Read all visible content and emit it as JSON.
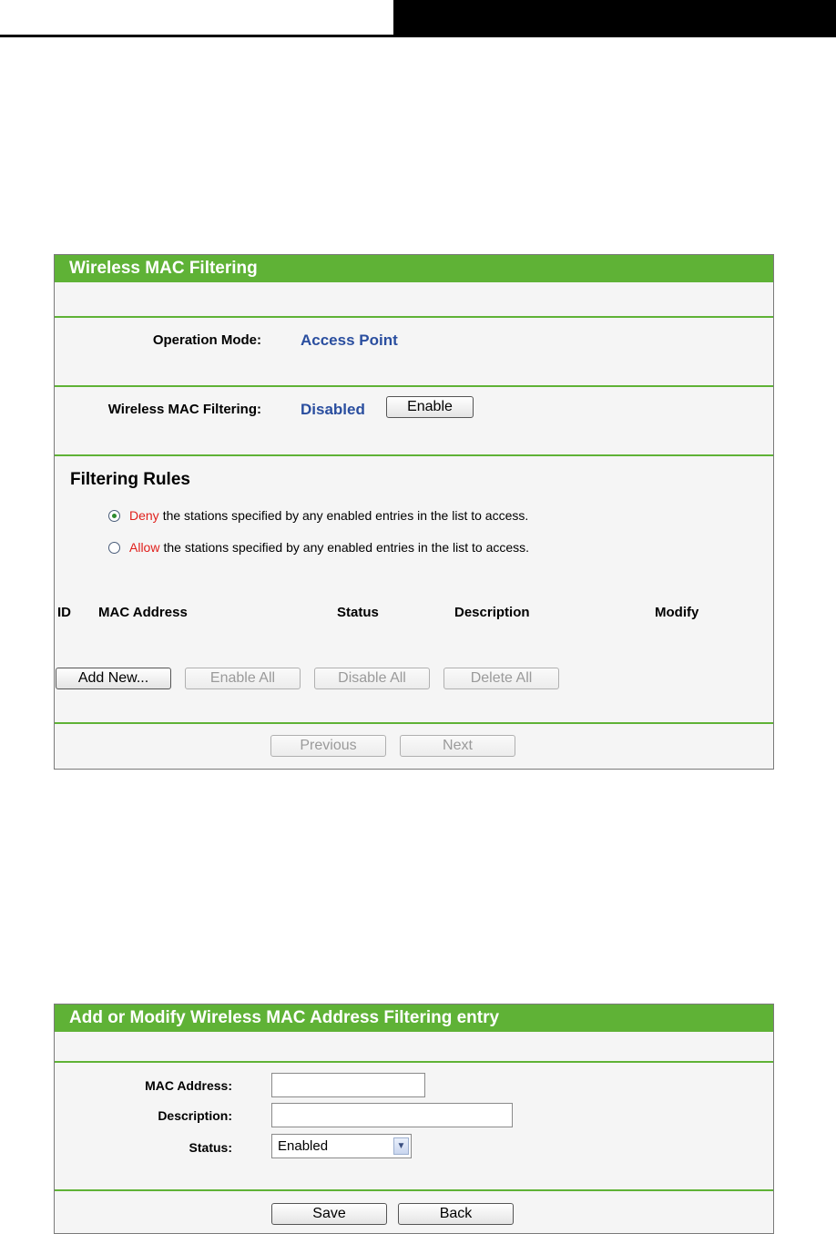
{
  "filtering_panel": {
    "title": "Wireless MAC Filtering",
    "operation_mode_label": "Operation Mode:",
    "operation_mode_value": "Access Point",
    "mac_filtering_label": "Wireless MAC Filtering:",
    "mac_filtering_value": "Disabled",
    "enable_button": "Enable",
    "rules_title": "Filtering Rules",
    "deny_keyword": "Deny",
    "deny_text": "the stations specified by any enabled entries in the list to access.",
    "allow_keyword": "Allow",
    "allow_text": "the stations specified by any enabled entries in the list to access.",
    "selected_rule": "deny",
    "table_headers": [
      "ID",
      "MAC Address",
      "Status",
      "Description",
      "Modify"
    ],
    "add_new_button": "Add New...",
    "enable_all_button": "Enable All",
    "disable_all_button": "Disable All",
    "delete_all_button": "Delete All",
    "previous_button": "Previous",
    "next_button": "Next"
  },
  "entry_panel": {
    "title": "Add or Modify Wireless MAC Address Filtering entry",
    "mac_address_label": "MAC Address:",
    "mac_address_value": "",
    "description_label": "Description:",
    "description_value": "",
    "status_label": "Status:",
    "status_value": "Enabled",
    "save_button": "Save",
    "back_button": "Back"
  },
  "colors": {
    "accent_green": "#5fb236",
    "value_blue": "#2a4e9f",
    "keyword_red": "#e0201c"
  }
}
